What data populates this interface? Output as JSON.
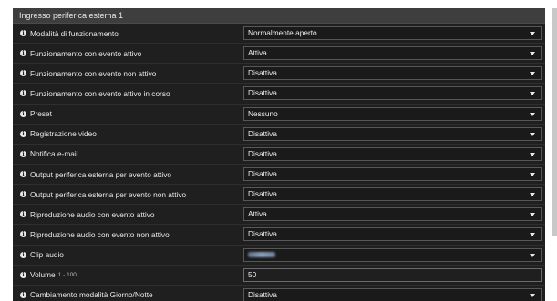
{
  "panel": {
    "title": "Ingresso periferica esterna 1"
  },
  "rows": [
    {
      "label": "Modalità di funzionamento",
      "value": "Normalmente aperto"
    },
    {
      "label": "Funzionamento con evento attivo",
      "value": "Attiva"
    },
    {
      "label": "Funzionamento con evento non attivo",
      "value": "Disattiva"
    },
    {
      "label": "Funzionamento con evento attivo in corso",
      "value": "Disattiva"
    },
    {
      "label": "Preset",
      "value": "Nessuno"
    },
    {
      "label": "Registrazione video",
      "value": "Disattiva"
    },
    {
      "label": "Notifica e-mail",
      "value": "Disattiva"
    },
    {
      "label": "Output periferica esterna per evento attivo",
      "value": "Disattiva"
    },
    {
      "label": "Output periferica esterna per evento non attivo",
      "value": "Disattiva"
    },
    {
      "label": "Riproduzione audio con evento attivo",
      "value": "Attiva"
    },
    {
      "label": "Riproduzione audio con evento non attivo",
      "value": "Disattiva"
    },
    {
      "label": "Clip audio",
      "value": ""
    },
    {
      "label": "Volume",
      "hint": "1 - 100",
      "value": "50"
    },
    {
      "label": "Cambiamento modalità Giorno/Notte",
      "value": "Disattiva"
    }
  ],
  "icons": {
    "info": "info-icon",
    "dropdown": "chevron-down-icon"
  }
}
